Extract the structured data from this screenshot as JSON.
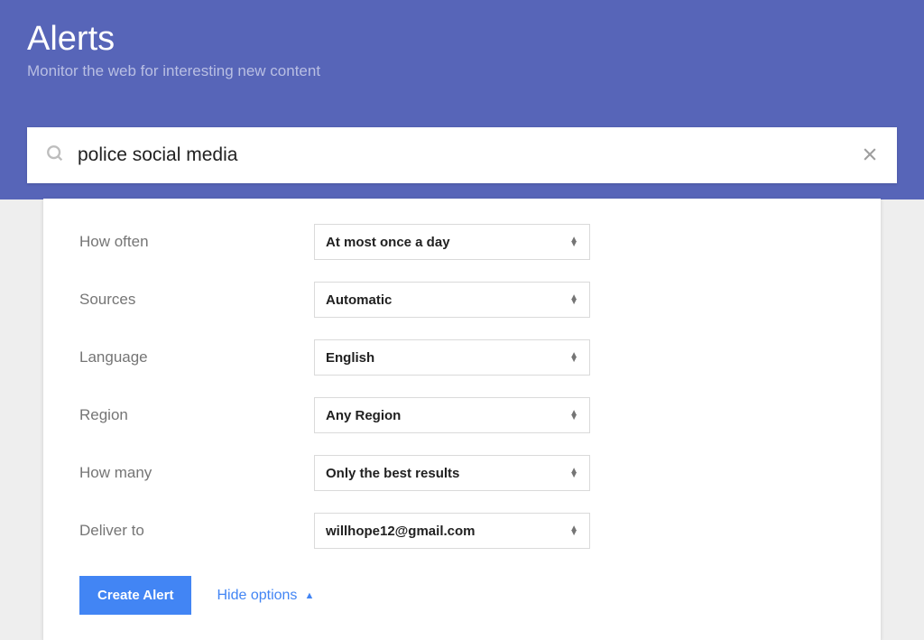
{
  "header": {
    "title": "Alerts",
    "subtitle": "Monitor the web for interesting new content"
  },
  "search": {
    "value": "police social media"
  },
  "options": {
    "rows": [
      {
        "label": "How often",
        "value": "At most once a day"
      },
      {
        "label": "Sources",
        "value": "Automatic"
      },
      {
        "label": "Language",
        "value": "English"
      },
      {
        "label": "Region",
        "value": "Any Region"
      },
      {
        "label": "How many",
        "value": "Only the best results"
      },
      {
        "label": "Deliver to",
        "value": "willhope12@gmail.com"
      }
    ]
  },
  "actions": {
    "create_label": "Create Alert",
    "hide_label": "Hide options"
  }
}
